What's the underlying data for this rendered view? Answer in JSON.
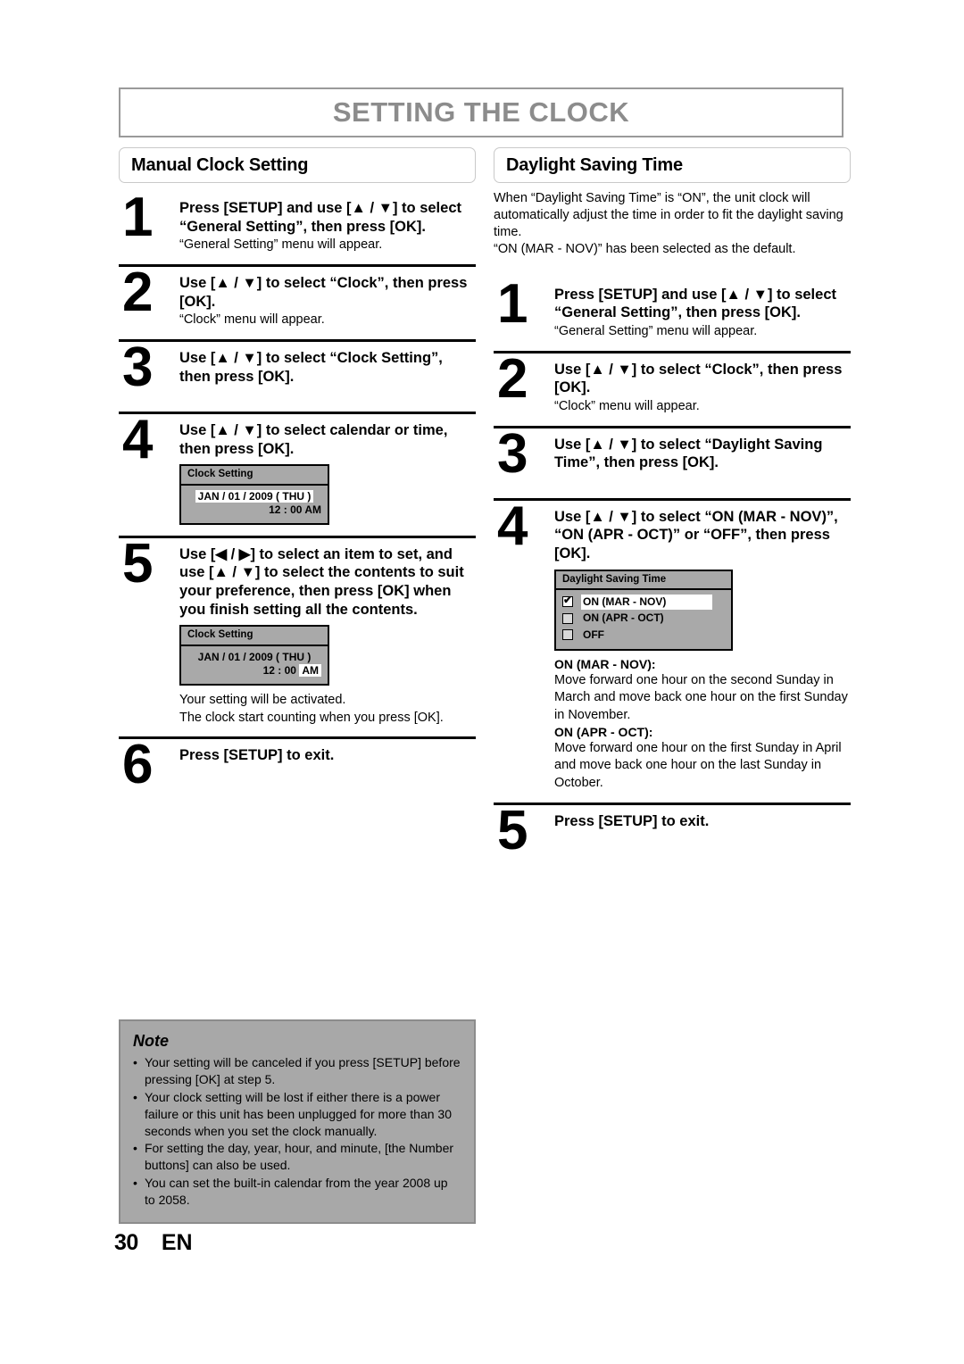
{
  "page": {
    "title": "SETTING THE CLOCK",
    "number": "30",
    "language": "EN"
  },
  "left_section": {
    "heading": "Manual Clock Setting",
    "steps": [
      {
        "number": "1",
        "title": "Press [SETUP] and use [▲ / ▼] to select “General Setting”, then press [OK].",
        "sub": "“General Setting” menu will appear."
      },
      {
        "number": "2",
        "title": "Use [▲ / ▼] to select “Clock”, then press [OK].",
        "sub": "“Clock” menu will appear."
      },
      {
        "number": "3",
        "title": "Use [▲ / ▼] to select “Clock Setting”, then press [OK].",
        "sub": ""
      },
      {
        "number": "4",
        "title": "Use [▲ / ▼] to select calendar or time, then press [OK].",
        "sub": ""
      },
      {
        "number": "5",
        "title": "Use [◀ / ▶] to select an item to set, and use [▲ / ▼] to select the contents to suit your preference, then press [OK] when you finish setting all the contents.",
        "sub": ""
      },
      {
        "number": "6",
        "title": "Press [SETUP] to exit.",
        "sub": ""
      }
    ],
    "osd_step4": {
      "title": "Clock Setting",
      "date": "JAN / 01 / 2009 ( THU )",
      "time": "12 : 00 AM",
      "highlight": "date"
    },
    "osd_step5": {
      "title": "Clock Setting",
      "date": "JAN / 01 / 2009 ( THU )",
      "time_value": "12 : 00 ",
      "time_meridiem": "AM",
      "highlight": "meridiem"
    },
    "step5_notes": [
      "Your setting will be activated.",
      "The clock start counting when you press [OK]."
    ]
  },
  "right_section": {
    "heading": "Daylight Saving Time",
    "intro": "When “Daylight Saving Time” is “ON”, the unit clock will automatically adjust the time in order to fit the daylight saving time.\n“ON (MAR - NOV)” has been selected as the default.",
    "steps": [
      {
        "number": "1",
        "title": "Press [SETUP] and use [▲ / ▼] to select “General Setting”, then press [OK].",
        "sub": "“General Setting” menu will appear."
      },
      {
        "number": "2",
        "title": "Use [▲ / ▼] to select “Clock”, then press [OK].",
        "sub": "“Clock” menu will appear."
      },
      {
        "number": "3",
        "title": "Use [▲ / ▼] to select “Daylight Saving Time”, then press [OK].",
        "sub": ""
      },
      {
        "number": "4",
        "title": "Use [▲ / ▼] to select “ON (MAR - NOV)”, “ON (APR - OCT)” or “OFF”, then press [OK].",
        "sub": ""
      },
      {
        "number": "5",
        "title": "Press [SETUP] to exit.",
        "sub": ""
      }
    ],
    "osd_dst": {
      "title": "Daylight Saving Time",
      "options": [
        {
          "label": "ON (MAR - NOV)",
          "checked": true
        },
        {
          "label": "ON (APR - OCT)",
          "checked": false
        },
        {
          "label": "OFF",
          "checked": false
        }
      ]
    },
    "descriptions": [
      {
        "label": "ON (MAR - NOV):",
        "text": "Move forward one hour on the second Sunday in March and move back one hour on the first Sunday in November."
      },
      {
        "label": "ON (APR - OCT):",
        "text": "Move forward one hour on the first Sunday in April and move back one hour on the last Sunday in October."
      }
    ]
  },
  "note": {
    "title": "Note",
    "bullet": "•",
    "items": [
      "Your setting will be canceled if you press [SETUP] before pressing [OK] at step 5.",
      "Your clock setting will be lost if either there is a power failure or this unit has been unplugged for more than 30 seconds when you set the clock manually.",
      "For setting the day, year, hour, and minute, [the Number buttons] can also be used.",
      "You can set the built-in calendar from the year 2008 up to 2058."
    ]
  },
  "colors": {
    "title_gray": "#8c8c8c",
    "osd_gray": "#a9a9a9",
    "note_gray": "#a8a8a8",
    "highlight_white": "#ffffff"
  }
}
